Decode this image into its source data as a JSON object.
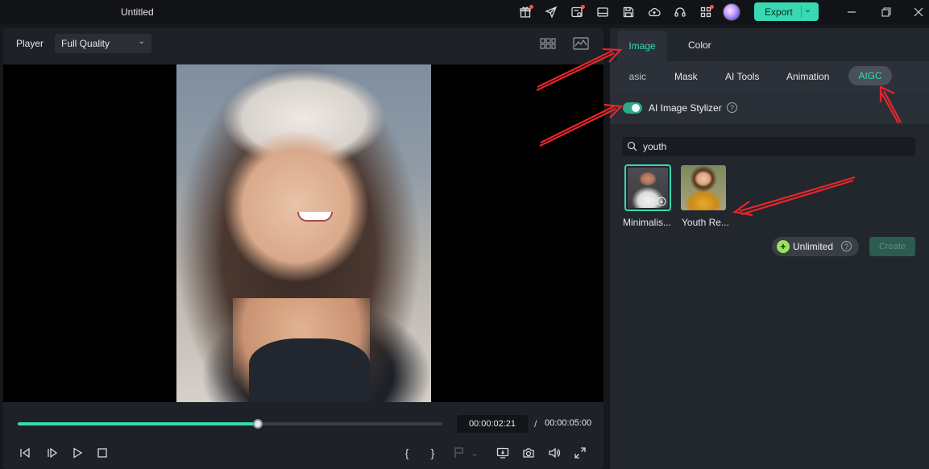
{
  "window": {
    "title": "Untitled",
    "export_label": "Export",
    "toolbar_icons": [
      "gift-icon",
      "send-icon",
      "task-icon",
      "layout-icon",
      "save-icon",
      "cloud-upload-icon",
      "headset-icon",
      "grid-icon"
    ],
    "window_controls": [
      "minimize-icon",
      "restore-icon",
      "close-icon"
    ]
  },
  "player": {
    "label": "Player",
    "quality": "Full Quality",
    "progress_fraction": 0.566,
    "current_time": "00:00:02:21",
    "separator": "/",
    "total_time": "00:00:05:00",
    "mark_in": "{",
    "mark_out": "}"
  },
  "panel": {
    "tabs": [
      "Image",
      "Color"
    ],
    "subtabs": [
      "asic",
      "Mask",
      "AI Tools",
      "Animation",
      "AIGC"
    ],
    "active_subtab": "AIGC",
    "stylizer_label": "AI Image Stylizer",
    "stylizer_enabled": true,
    "search_value": "youth",
    "styles": [
      {
        "label": "Minimalis...",
        "selected": true
      },
      {
        "label": "Youth Re...",
        "selected": false
      }
    ],
    "unlimited_label": "Unlimited",
    "create_label": "Create"
  },
  "colors": {
    "accent": "#38d9b3",
    "background": "#16181d",
    "panel": "#22262d",
    "annotation_arrow": "#e5262b"
  }
}
